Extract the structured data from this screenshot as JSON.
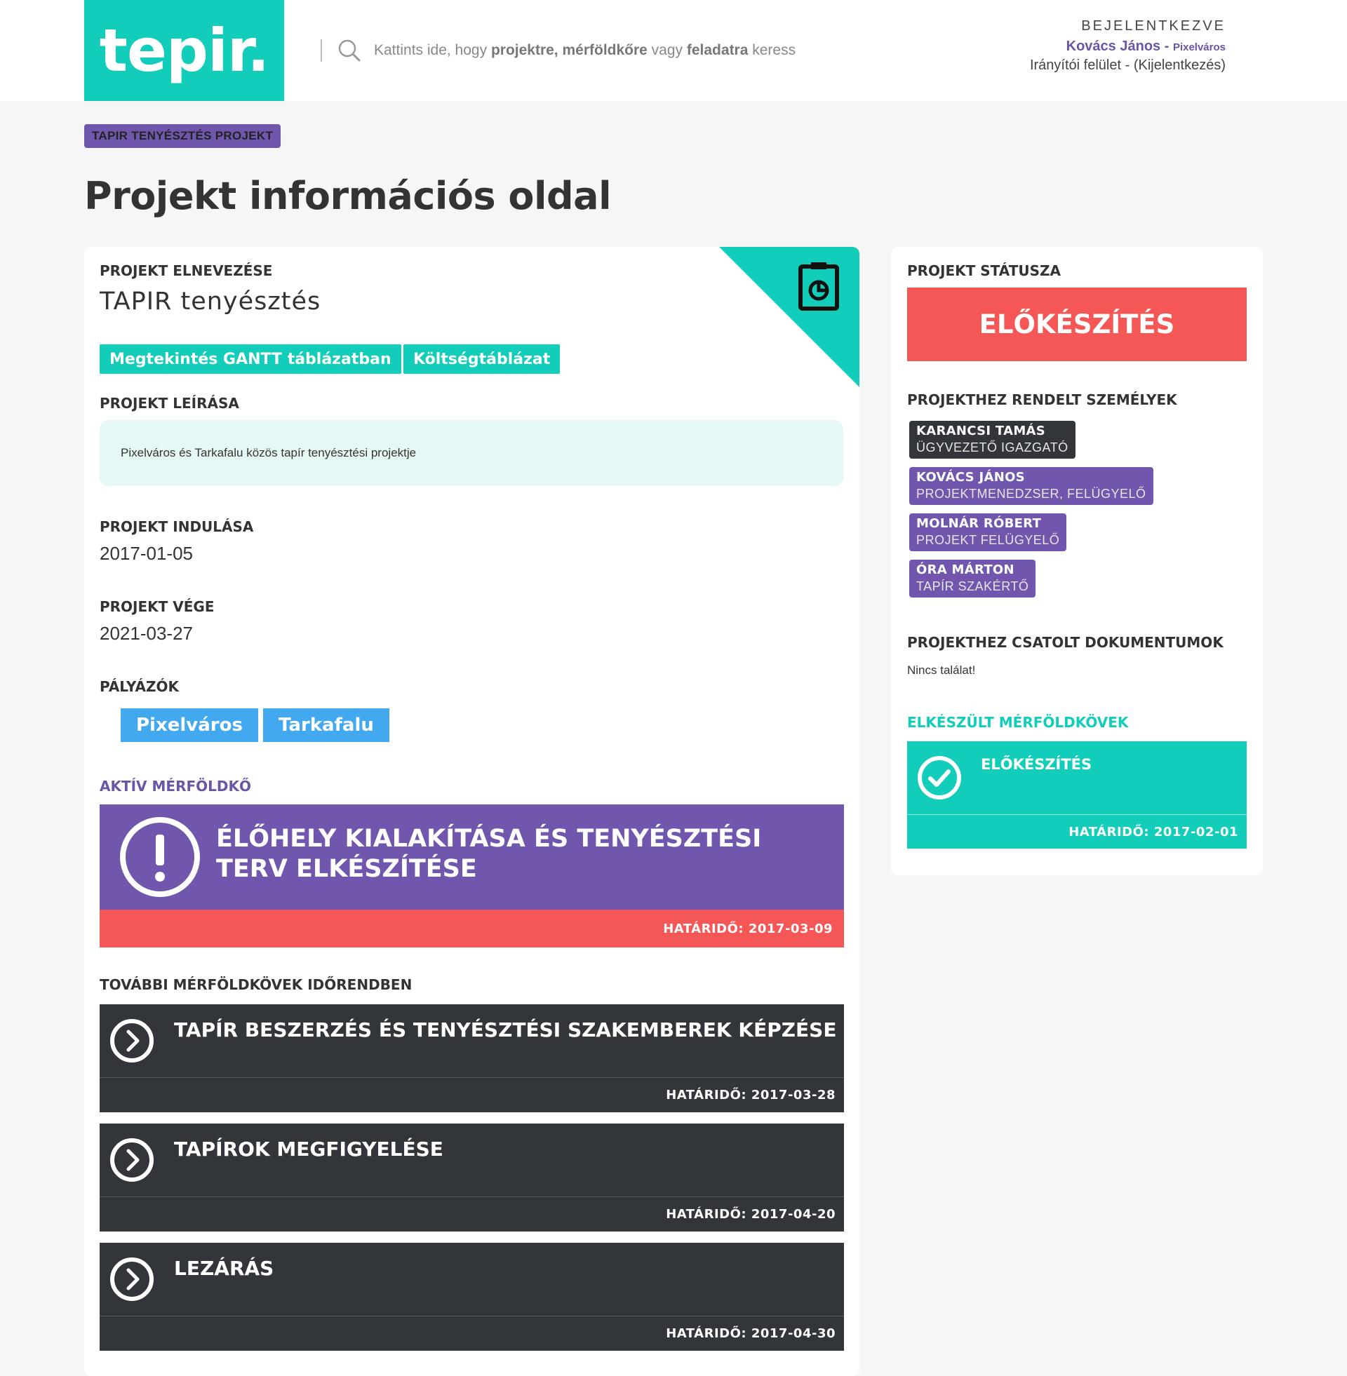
{
  "header": {
    "logo": "tepir.",
    "search_text_1": "Kattints ide, hogy ",
    "search_text_2": "projektre, mérföldkőre",
    "search_text_3": " vagy ",
    "search_text_4": "feladatra",
    "search_text_5": " keress",
    "logged_in_label": "BEJELENTKEZVE",
    "user_name": "Kovács János",
    "user_sep": " - ",
    "user_city": "Pixelváros",
    "dashboard_link": "Irányítói felület",
    "links_sep": " - ",
    "logout_link": "(Kijelentkezés)"
  },
  "breadcrumb": "TAPIR TENYÉSZTÉS PROJEKT",
  "page_title": "Projekt információs oldal",
  "project": {
    "name_label": "PROJEKT ELNEVEZÉSE",
    "name": "TAPIR tenyésztés",
    "gantt_button": "Megtekintés GANTT táblázatban",
    "cost_button": "Költségtáblázat",
    "description_label": "PROJEKT LEÍRÁSA",
    "description": "Pixelváros és Tarkafalu közös tapír tenyésztési projektje",
    "start_label": "PROJEKT INDULÁSA",
    "start": "2017-01-05",
    "end_label": "PROJEKT VÉGE",
    "end": "2021-03-27",
    "applicants_label": "PÁLYÁZÓK",
    "applicants": [
      "Pixelváros",
      "Tarkafalu"
    ],
    "active_milestone_label": "AKTÍV MÉRFÖLDKŐ",
    "active_milestone": {
      "title": "ÉLŐHELY KIALAKÍTÁSA ÉS TENYÉSZTÉSI TERV ELKÉSZÍTÉSE",
      "deadline": "HATÁRIDŐ: 2017-03-09"
    },
    "further_milestones_label": "TOVÁBBI MÉRFÖLDKÖVEK IDŐRENDBEN",
    "further_milestones": [
      {
        "title": "TAPÍR BESZERZÉS ÉS TENYÉSZTÉSI SZAKEMBEREK KÉPZÉSE",
        "deadline": "HATÁRIDŐ: 2017-03-28"
      },
      {
        "title": "TAPÍROK MEGFIGYELÉSE",
        "deadline": "HATÁRIDŐ: 2017-04-20"
      },
      {
        "title": "LEZÁRÁS",
        "deadline": "HATÁRIDŐ: 2017-04-30"
      }
    ]
  },
  "sidebar": {
    "status_label": "PROJEKT STÁTUSZA",
    "status": "ELŐKÉSZÍTÉS",
    "people_label": "PROJEKTHEZ RENDELT SZEMÉLYEK",
    "people": [
      {
        "name": "KARANCSI TAMÁS",
        "role": "ÜGYVEZETŐ IGAZGATÓ"
      },
      {
        "name": "KOVÁCS JÁNOS",
        "role": "PROJEKTMENEDZSER, FELÜGYELŐ"
      },
      {
        "name": "MOLNÁR RÓBERT",
        "role": "PROJEKT FELÜGYELŐ"
      },
      {
        "name": "ÓRA MÁRTON",
        "role": "TAPÍR SZAKÉRTŐ"
      }
    ],
    "documents_label": "PROJEKTHEZ CSATOLT DOKUMENTUMOK",
    "documents_empty": "Nincs találat!",
    "completed_label": "ELKÉSZÜLT MÉRFÖLDKÖVEK",
    "completed": [
      {
        "title": "ELŐKÉSZÍTÉS",
        "deadline": "HATÁRIDŐ: 2017-02-01"
      }
    ]
  },
  "colors": {
    "teal": "#12cdb9",
    "purple": "#7057ad",
    "red": "#f55756",
    "dark": "#32353a",
    "blue": "#42a9f1"
  }
}
